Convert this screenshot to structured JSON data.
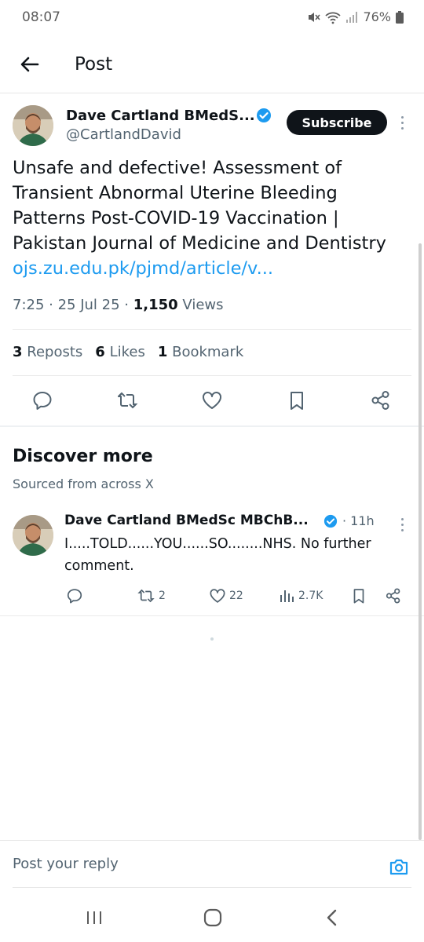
{
  "status_bar": {
    "time": "08:07",
    "battery": "76%"
  },
  "header": {
    "title": "Post"
  },
  "post": {
    "author_name": "Dave Cartland BMedS...",
    "handle": "@CartlandDavid",
    "subscribe_label": "Subscribe",
    "text": "Unsafe and defective! Assessment of Transient Abnormal Uterine Bleeding Patterns Post-COVID-19 Vaccination | Pakistan Journal of Medicine and Dentistry",
    "link": "ojs.zu.edu.pk/pjmd/article/v...",
    "time": "7:25",
    "date": "25 Jul 25",
    "views_count": "1,150",
    "views_label": "Views",
    "reposts_count": "3",
    "reposts_label": "Reposts",
    "likes_count": "6",
    "likes_label": "Likes",
    "bookmarks_count": "1",
    "bookmarks_label": "Bookmark"
  },
  "discover": {
    "title": "Discover more",
    "subtitle": "Sourced from across X",
    "item": {
      "author_name": "Dave Cartland BMedSc MBChB...",
      "time": "11h",
      "text": "I.....TOLD......YOU......SO........NHS. No further comment.",
      "reposts": "2",
      "likes": "22",
      "views": "2.7K"
    }
  },
  "reply": {
    "placeholder": "Post your reply"
  },
  "colors": {
    "accent": "#1d9bf0",
    "text": "#0f1419",
    "secondary": "#536471"
  },
  "icons": [
    "back-arrow-icon",
    "verified-badge-icon",
    "more-icon",
    "reply-icon",
    "repost-icon",
    "like-icon",
    "bookmark-icon",
    "share-icon",
    "views-icon",
    "camera-icon",
    "recent-apps-icon",
    "home-icon",
    "nav-back-icon",
    "mute-icon",
    "wifi-icon",
    "signal-icon",
    "battery-icon"
  ]
}
